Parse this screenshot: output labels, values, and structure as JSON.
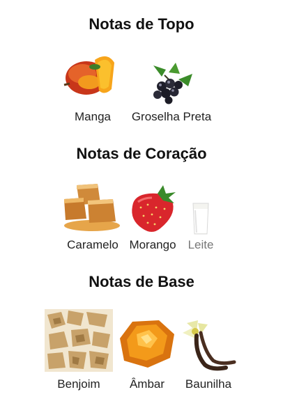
{
  "sections": [
    {
      "title": "Notas de Topo",
      "items": [
        {
          "label": "Manga",
          "icon": "mango-icon"
        },
        {
          "label": "Groselha Preta",
          "icon": "blackcurrant-icon"
        }
      ]
    },
    {
      "title": "Notas de Coração",
      "items": [
        {
          "label": "Caramelo",
          "icon": "caramel-icon"
        },
        {
          "label": "Morango",
          "icon": "strawberry-icon"
        },
        {
          "label": "Leite",
          "icon": "milk-icon"
        }
      ]
    },
    {
      "title": "Notas de Base",
      "items": [
        {
          "label": "Benjoim",
          "icon": "benzoin-icon"
        },
        {
          "label": "Âmbar",
          "icon": "amber-icon"
        },
        {
          "label": "Baunilha",
          "icon": "vanilla-icon"
        }
      ]
    }
  ]
}
